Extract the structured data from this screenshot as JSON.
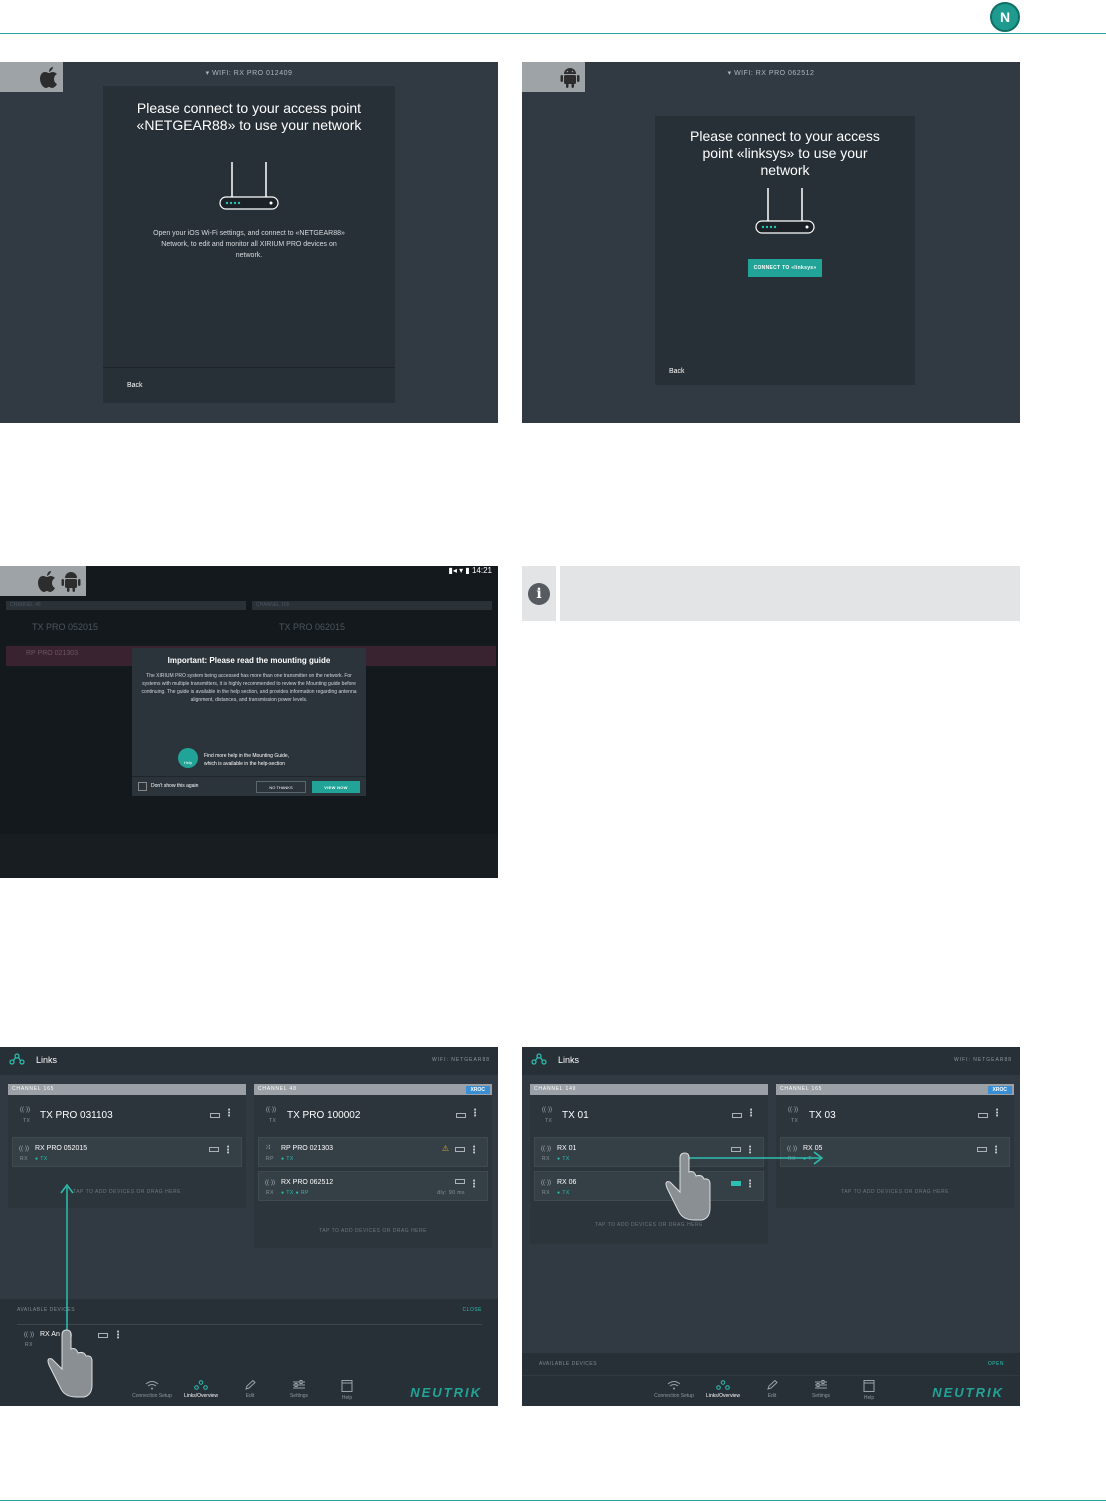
{
  "screens": {
    "ios_connect": {
      "wifi_label": "WIFI: RX PRO 012409",
      "title": "Please connect to your access point «NETGEAR88» to use your network",
      "body": "Open your iOS Wi-Fi settings, and connect to «NETGEAR88» Network, to edit and monitor all XIRIUM PRO devices on network.",
      "back": "Back"
    },
    "android_connect": {
      "wifi_label": "WIFI: RX PRO 062512",
      "title": "Please connect to your access point «linksys» to use your network",
      "button": "CONNECT TO «linksys»",
      "back": "Back"
    },
    "mounting_guide": {
      "status_time": "14:21",
      "bg_channel_a": "CHANNEL 48",
      "bg_channel_b": "CHANNEL 165",
      "bg_tx_a": "TX PRO 052015",
      "bg_tx_b": "TX PRO 062015",
      "bg_rp": "RP PRO 021303",
      "title": "Important: Please read the mounting guide",
      "body": "The XIRIUM PRO system being accessed has more than one transmitter on the network. For systems with multiple transmitters, it is highly recommended to review the Mounting guide before continuing. The guide is available in the help section, and provides information regarding antenna alignment, distances, and transmission power levels.",
      "help_badge": "Help",
      "help_line1": "Find more help in the Mounting Guide,",
      "help_line2": "which is available in the help-section",
      "dont_show": "Don't show this again",
      "no_thanks": "NO THANKS",
      "view_now": "VIEW NOW"
    },
    "links_a": {
      "title": "Links",
      "wifi": "WIFI: NETGEAR88",
      "ch1": {
        "label": "CHANNEL 165",
        "tx_name": "TX PRO 031103",
        "tx_role": "TX",
        "rx_name": "RX PRO 052015",
        "rx_role": "RX",
        "rx_link": "● TX",
        "tap": "TAP TO ADD DEVICES OR DRAG HERE"
      },
      "ch2": {
        "label": "CHANNEL 48",
        "badge": "XROC",
        "tx_name": "TX PRO 100002",
        "tx_role": "TX",
        "rp_name": "RP PRO 021303",
        "rp_role": "RP",
        "rp_link": "● TX",
        "rx_name": "RX PRO 062512",
        "rx_role": "RX",
        "rx_link": "● TX ● RP",
        "rx_delay": "dly: 90 ms",
        "tap": "TAP TO ADD DEVICES OR DRAG HERE"
      },
      "available_label": "AVAILABLE DEVICES",
      "available_action": "CLOSE",
      "available_dev_name": "RX An   14",
      "available_dev_role": "RX"
    },
    "links_b": {
      "title": "Links",
      "wifi": "WIFI: NETGEAR88",
      "ch1": {
        "label": "CHANNEL 149",
        "tx_name": "TX 01",
        "tx_role": "TX",
        "rx1_name": "RX 01",
        "rx1_role": "RX",
        "rx1_link": "● TX",
        "rx2_name": "RX 06",
        "rx2_role": "RX",
        "rx2_link": "● TX",
        "tap": "TAP TO ADD DEVICES OR DRAG HERE"
      },
      "ch2": {
        "label": "CHANNEL 165",
        "badge": "XROC",
        "tx_name": "TX 03",
        "tx_role": "TX",
        "rx_name": "RX 05",
        "rx_role": "RX",
        "rx_link": "● T",
        "tap": "TAP TO ADD DEVICES OR DRAG HERE"
      },
      "available_label": "AVAILABLE DEVICES",
      "available_action": "OPEN"
    }
  },
  "tabbar": {
    "tabs": [
      "Connection Setup",
      "Links/Overview",
      "Edit",
      "Settings",
      "Help"
    ],
    "active": "Links/Overview",
    "brand": "NEUTRIK"
  },
  "colors": {
    "accent": "#21a497",
    "screen_bg": "#313a42",
    "dialog_bg": "#283037",
    "xroc": "#3a8ed3"
  }
}
